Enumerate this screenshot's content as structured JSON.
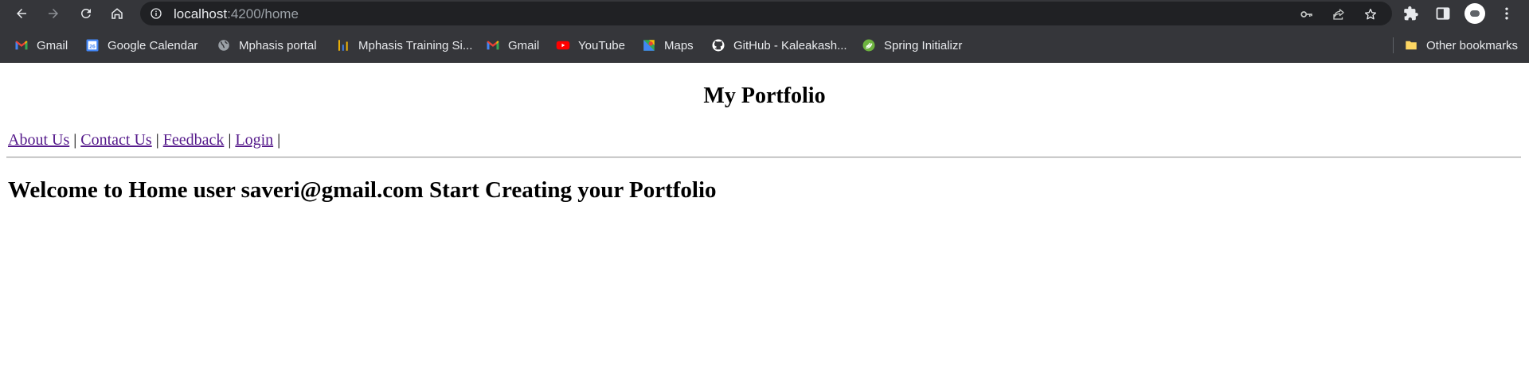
{
  "browser": {
    "url_host": "localhost",
    "url_path": ":4200/home",
    "colors": {
      "toolbar_bg": "#35363a",
      "omnibox_bg": "#202124"
    },
    "icons": {
      "back": "back-arrow-icon",
      "forward": "forward-arrow-icon",
      "reload": "reload-icon",
      "home": "home-icon",
      "site_info": "info-icon",
      "password": "key-icon",
      "share": "share-icon",
      "bookmark": "star-icon",
      "extensions": "puzzle-icon",
      "side_panel": "side-panel-icon",
      "profile": "avatar-icon",
      "menu": "kebab-menu-icon"
    }
  },
  "bookmarks": {
    "items": [
      {
        "label": "Gmail",
        "icon": "gmail-icon"
      },
      {
        "label": "Google Calendar",
        "icon": "calendar-icon"
      },
      {
        "label": "Mphasis portal",
        "icon": "globe-icon"
      },
      {
        "label": "Mphasis Training Si...",
        "icon": "bars-icon"
      },
      {
        "label": "Gmail",
        "icon": "gmail-icon"
      },
      {
        "label": "YouTube",
        "icon": "youtube-icon"
      },
      {
        "label": "Maps",
        "icon": "maps-icon"
      },
      {
        "label": "GitHub - Kaleakash...",
        "icon": "github-icon"
      },
      {
        "label": "Spring Initializr",
        "icon": "spring-icon"
      }
    ],
    "other": {
      "label": "Other bookmarks",
      "icon": "folder-icon"
    }
  },
  "page": {
    "title": "My Portfolio",
    "nav": [
      "About Us",
      "Contact Us",
      "Feedback",
      "Login"
    ],
    "separator": "|",
    "welcome": "Welcome to Home user saveri@gmail.com Start Creating your Portfolio",
    "colors": {
      "link": "#551a8b"
    }
  }
}
